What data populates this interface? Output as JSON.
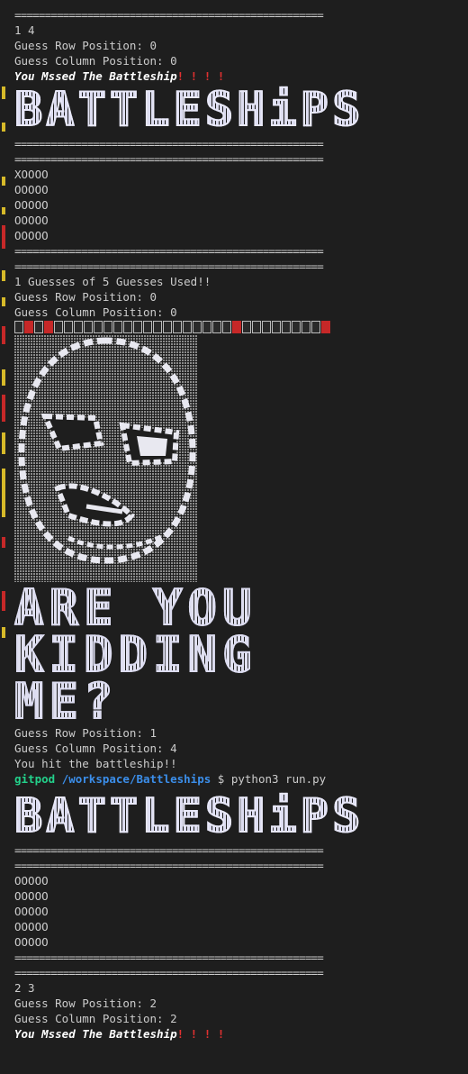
{
  "rule": "===================================================",
  "block1": {
    "coords": "1 4",
    "row": "Guess Row Position: 0",
    "col": "Guess Column Position: 0",
    "missed": "You Mssed The Battleship",
    "bangs": "! ! ! !"
  },
  "banner_text": "BATTLESHiPS",
  "grid1": [
    "XOOOO",
    "OOOOO",
    "OOOOO",
    "OOOOO",
    "OOOOO"
  ],
  "block2": {
    "used": "1 Guesses of 5 Guesses Used!!",
    "row": "Guess Row Position: 0",
    "col": "Guess Column Position: 0"
  },
  "kidding": [
    "ARE YOU",
    "KIDDING",
    "ME?"
  ],
  "block3": {
    "row": "Guess Row Position: 1",
    "col": "Guess Column Position: 4",
    "hit": "You hit the battleship!!"
  },
  "prompt": {
    "user": "gitpod",
    "path": "/workspace/Battleships",
    "cmd": "$ python3 run.py"
  },
  "grid2": [
    "OOOOO",
    "OOOOO",
    "OOOOO",
    "OOOOO",
    "OOOOO"
  ],
  "block4": {
    "coords": "2 3",
    "row": "Guess Row Position: 2",
    "col": "Guess Column Position: 2",
    "missed": "You Mssed The Battleship",
    "bangs": "! ! ! !"
  },
  "colors": {
    "background": "#1e1e1e",
    "text": "#cccccc",
    "alert": "#e03030",
    "prompt_user": "#23d18b",
    "prompt_path": "#3b8eea",
    "gutter_yellow": "#d7ba29",
    "gutter_red": "#c62828"
  }
}
